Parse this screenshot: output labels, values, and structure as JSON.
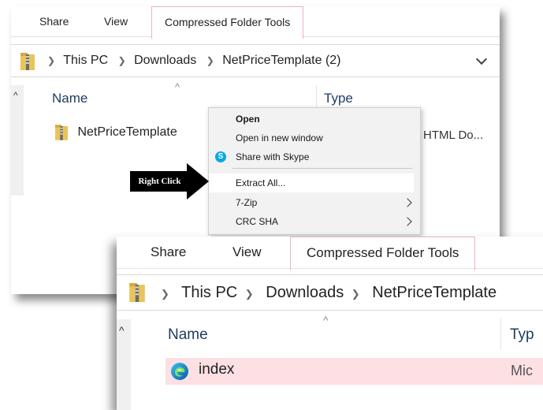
{
  "top_window": {
    "tabs": [
      "Share",
      "View",
      "Compressed Folder Tools"
    ],
    "breadcrumb": [
      "This PC",
      "Downloads",
      "NetPriceTemplate (2)"
    ],
    "columns": {
      "name": "Name",
      "type": "Type"
    },
    "file": {
      "name": "NetPriceTemplate",
      "type": "HTML Do..."
    }
  },
  "context_menu": {
    "items": [
      "Open",
      "Open in new window",
      "Share with Skype",
      "Extract All...",
      "7-Zip",
      "CRC SHA"
    ],
    "skype_glyph": "S"
  },
  "callout": {
    "text": "Right Click"
  },
  "bottom_window": {
    "tabs": [
      "Share",
      "View",
      "Compressed Folder Tools"
    ],
    "breadcrumb": [
      "This PC",
      "Downloads",
      "NetPriceTemplate"
    ],
    "columns": {
      "name": "Name",
      "type": "Typ"
    },
    "file": {
      "name": "index",
      "type": "Mic"
    }
  },
  "icons": {
    "zip_folder": "zip-folder-icon",
    "edge": "edge-icon",
    "skype": "skype-icon"
  },
  "colors": {
    "active_tab_border": "#e9b3c4",
    "selected_row": "#fde0e4",
    "menu_bg": "#f2f2f2",
    "callout_bg": "#000000"
  }
}
